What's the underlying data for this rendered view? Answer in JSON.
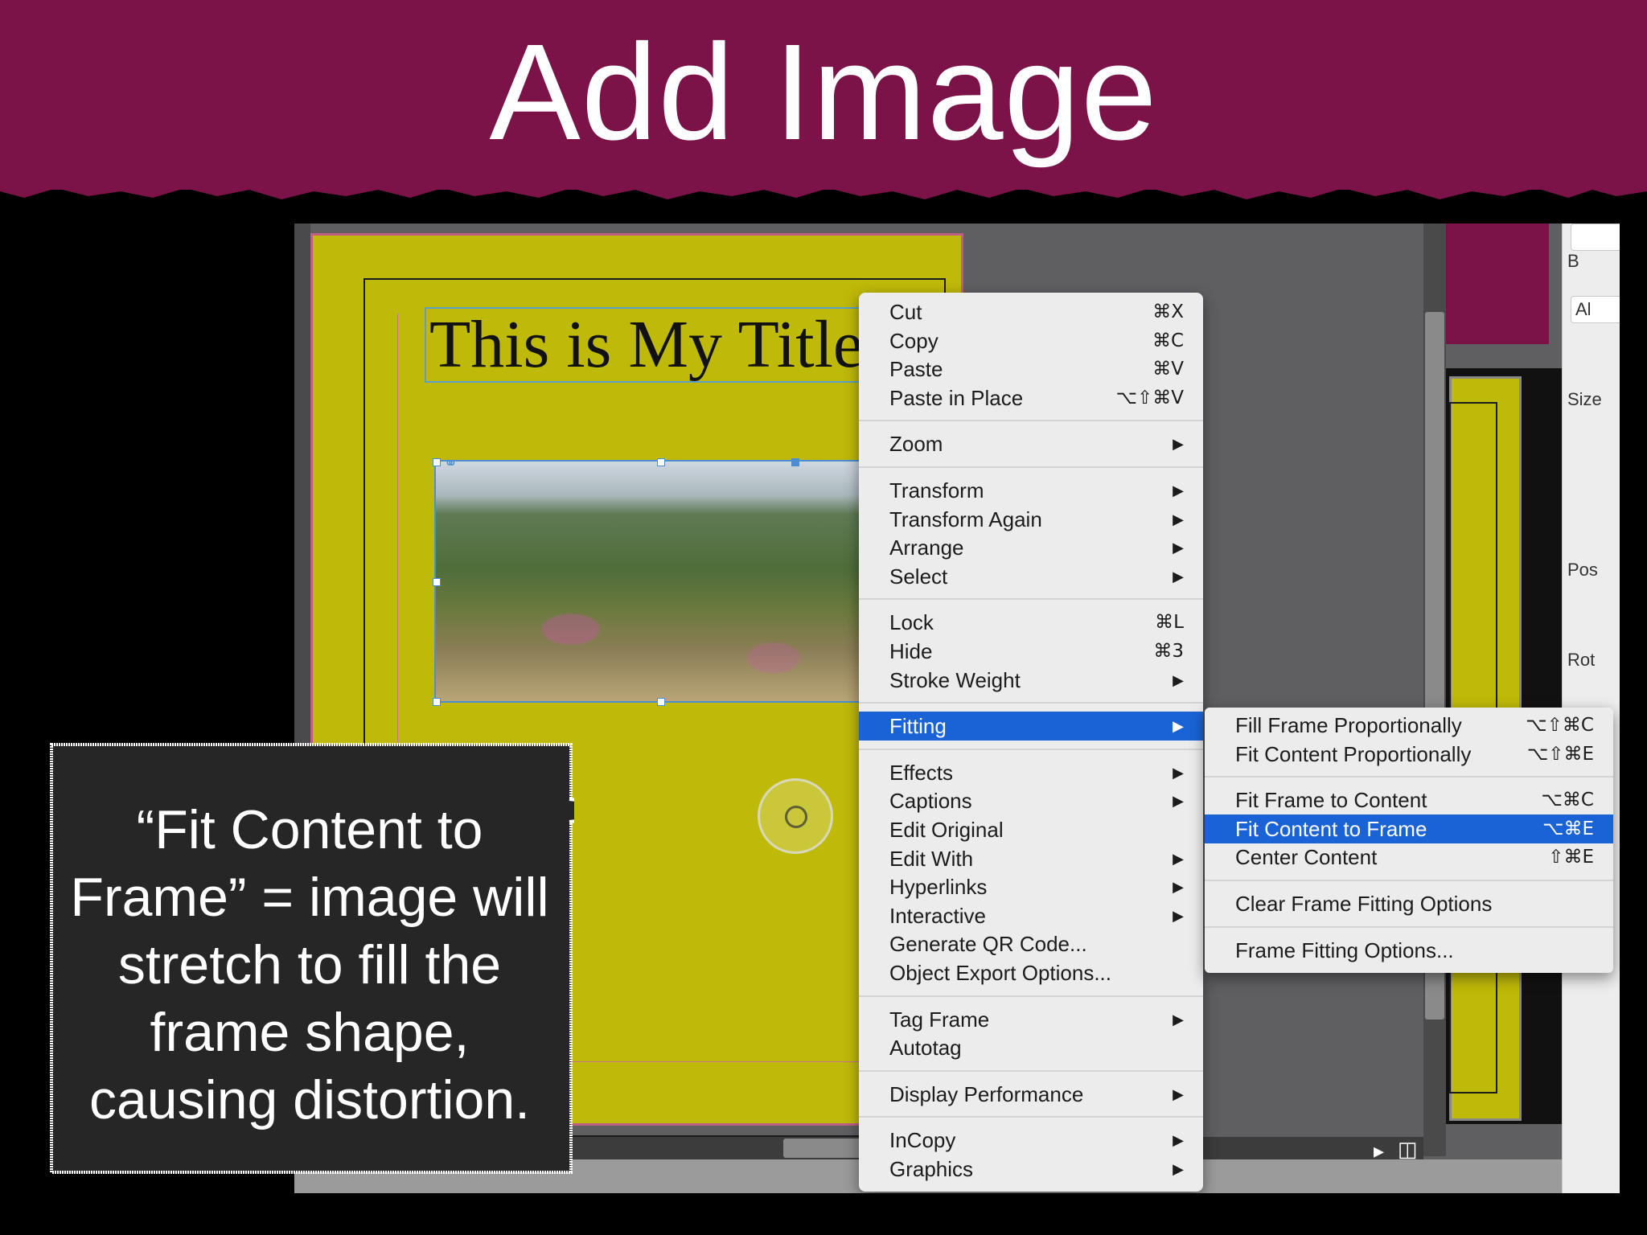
{
  "slide": {
    "title": "Add Image"
  },
  "document": {
    "title_text": "This is My Title!"
  },
  "context_menu": {
    "groups": [
      [
        {
          "label": "Cut",
          "shortcut": "⌘X"
        },
        {
          "label": "Copy",
          "shortcut": "⌘C"
        },
        {
          "label": "Paste",
          "shortcut": "⌘V"
        },
        {
          "label": "Paste in Place",
          "shortcut": "⌥⇧⌘V"
        }
      ],
      [
        {
          "label": "Zoom",
          "submenu": true
        }
      ],
      [
        {
          "label": "Transform",
          "submenu": true
        },
        {
          "label": "Transform Again",
          "submenu": true
        },
        {
          "label": "Arrange",
          "submenu": true
        },
        {
          "label": "Select",
          "submenu": true
        }
      ],
      [
        {
          "label": "Lock",
          "shortcut": "⌘L"
        },
        {
          "label": "Hide",
          "shortcut": "⌘3"
        },
        {
          "label": "Stroke Weight",
          "submenu": true
        }
      ],
      [
        {
          "label": "Fitting",
          "submenu": true,
          "highlighted": true
        }
      ],
      [
        {
          "label": "Effects",
          "submenu": true
        },
        {
          "label": "Captions",
          "submenu": true
        },
        {
          "label": "Edit Original"
        },
        {
          "label": "Edit With",
          "submenu": true
        },
        {
          "label": "Hyperlinks",
          "submenu": true
        },
        {
          "label": "Interactive",
          "submenu": true
        },
        {
          "label": "Generate QR Code..."
        },
        {
          "label": "Object Export Options..."
        }
      ],
      [
        {
          "label": "Tag Frame",
          "submenu": true
        },
        {
          "label": "Autotag"
        }
      ],
      [
        {
          "label": "Display Performance",
          "submenu": true
        }
      ],
      [
        {
          "label": "InCopy",
          "submenu": true
        },
        {
          "label": "Graphics",
          "submenu": true
        }
      ]
    ]
  },
  "fitting_submenu": {
    "groups": [
      [
        {
          "label": "Fill Frame Proportionally",
          "shortcut": "⌥⇧⌘C"
        },
        {
          "label": "Fit Content Proportionally",
          "shortcut": "⌥⇧⌘E"
        }
      ],
      [
        {
          "label": "Fit Frame to Content",
          "shortcut": "⌥⌘C"
        },
        {
          "label": "Fit Content to Frame",
          "shortcut": "⌥⌘E",
          "highlighted": true
        },
        {
          "label": "Center Content",
          "shortcut": "⇧⌘E"
        }
      ],
      [
        {
          "label": "Clear Frame Fitting Options"
        }
      ],
      [
        {
          "label": "Frame Fitting Options..."
        }
      ]
    ]
  },
  "side_panel": {
    "items": [
      "B",
      "Al",
      "Size",
      "Pos",
      "Rot"
    ]
  },
  "callout": {
    "lines": [
      "“Fit Content to",
      "Frame” = image will",
      "stretch to fill the",
      "frame shape,",
      "causing distortion."
    ]
  },
  "colors": {
    "banner": "#7b1348",
    "page": "#bfb90a",
    "highlight": "#1a63d6",
    "menu_bg": "#ececec"
  },
  "icons": {
    "link": "link-icon",
    "submenu_arrow": "triangle-right-icon",
    "content_grabber": "content-grabber-icon"
  }
}
